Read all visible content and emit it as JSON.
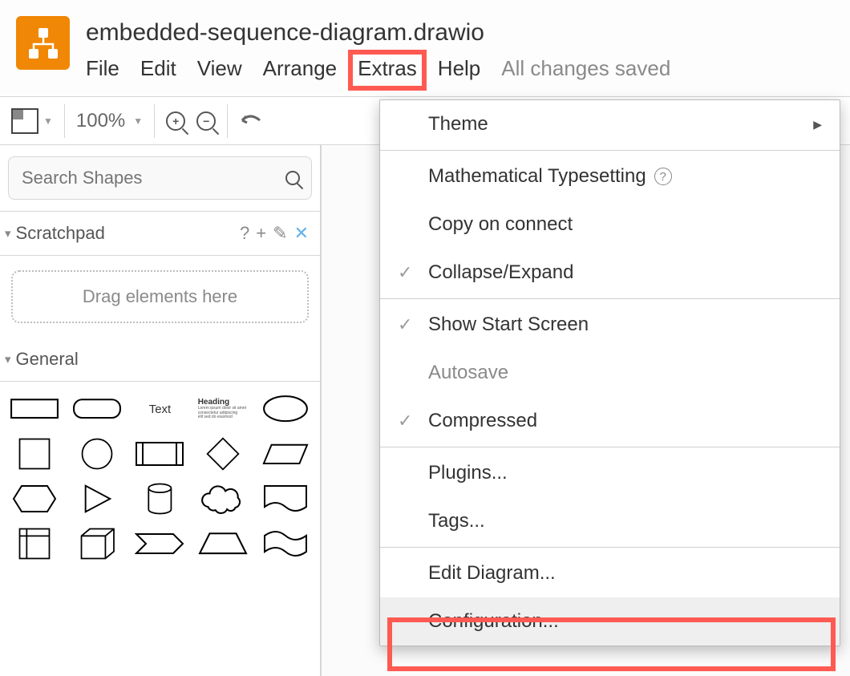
{
  "title": "embedded-sequence-diagram.drawio",
  "menubar": {
    "file": "File",
    "edit": "Edit",
    "view": "View",
    "arrange": "Arrange",
    "extras": "Extras",
    "help": "Help",
    "saved": "All changes saved"
  },
  "toolbar": {
    "zoom": "100%"
  },
  "sidebar": {
    "search_placeholder": "Search Shapes",
    "scratchpad_label": "Scratchpad",
    "drag_label": "Drag elements here",
    "general_label": "General",
    "shape_text": "Text",
    "shape_heading": "Heading"
  },
  "dropdown": {
    "theme": "Theme",
    "math": "Mathematical Typesetting",
    "copy_connect": "Copy on connect",
    "collapse": "Collapse/Expand",
    "start_screen": "Show Start Screen",
    "autosave": "Autosave",
    "compressed": "Compressed",
    "plugins": "Plugins...",
    "tags": "Tags...",
    "edit_diagram": "Edit Diagram...",
    "configuration": "Configuration..."
  }
}
